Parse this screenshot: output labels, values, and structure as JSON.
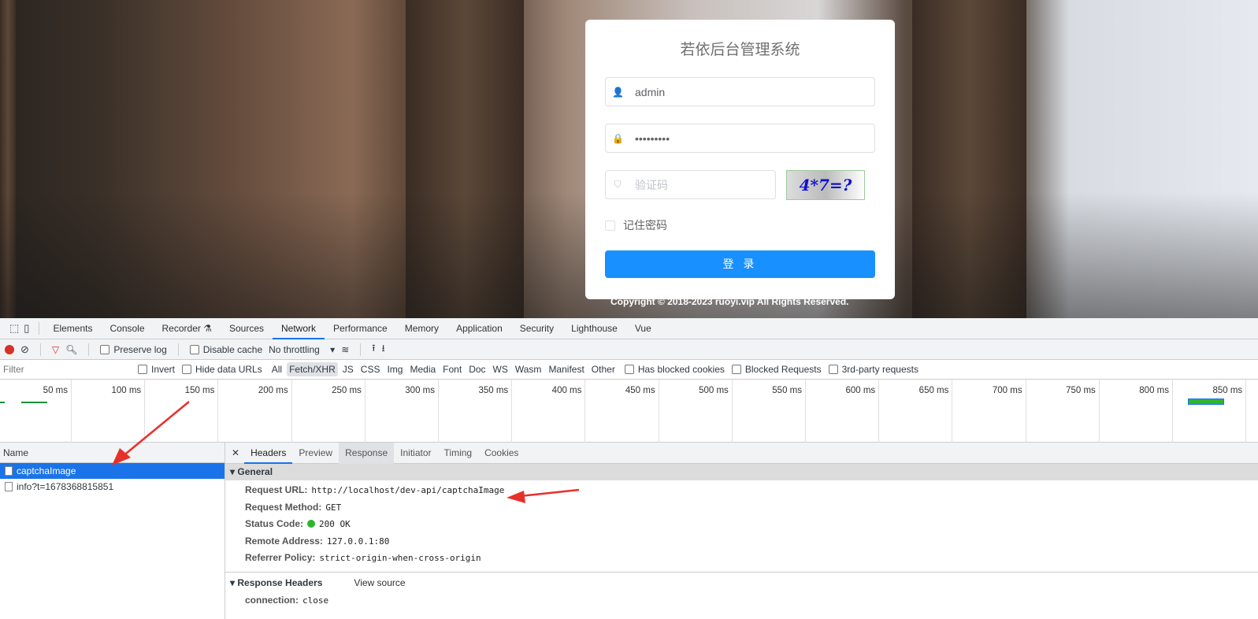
{
  "login": {
    "title": "若依后台管理系统",
    "username": "admin",
    "password": "•••••••••",
    "captcha_placeholder": "验证码",
    "captcha_text": "4*7=?",
    "remember": "记住密码",
    "submit": "登 录",
    "copyright": "Copyright © 2018-2023 ruoyi.vip All Rights Reserved."
  },
  "devtools": {
    "tabs": [
      "Elements",
      "Console",
      "Recorder ⚗",
      "Sources",
      "Network",
      "Performance",
      "Memory",
      "Application",
      "Security",
      "Lighthouse",
      "Vue"
    ],
    "active_tab": "Network",
    "toolbar": {
      "preserve_log": "Preserve log",
      "disable_cache": "Disable cache",
      "throttling": "No throttling"
    },
    "filter": {
      "placeholder": "Filter",
      "invert": "Invert",
      "hide_data_urls": "Hide data URLs",
      "types": [
        "All",
        "Fetch/XHR",
        "JS",
        "CSS",
        "Img",
        "Media",
        "Font",
        "Doc",
        "WS",
        "Wasm",
        "Manifest",
        "Other"
      ],
      "active_type": "Fetch/XHR",
      "blocked_cookies": "Has blocked cookies",
      "blocked_requests": "Blocked Requests",
      "third_party": "3rd-party requests"
    },
    "timeline_ticks": [
      "50 ms",
      "100 ms",
      "150 ms",
      "200 ms",
      "250 ms",
      "300 ms",
      "350 ms",
      "400 ms",
      "450 ms",
      "500 ms",
      "550 ms",
      "600 ms",
      "650 ms",
      "700 ms",
      "750 ms",
      "800 ms",
      "850 ms"
    ],
    "name_header": "Name",
    "requests": [
      {
        "name": "captchaImage",
        "selected": true
      },
      {
        "name": "info?t=1678368815851",
        "selected": false
      }
    ],
    "detail_tabs": [
      "Headers",
      "Preview",
      "Response",
      "Initiator",
      "Timing",
      "Cookies"
    ],
    "general_title": "General",
    "general": [
      {
        "key": "Request URL:",
        "value": "http://localhost/dev-api/captchaImage"
      },
      {
        "key": "Request Method:",
        "value": "GET"
      },
      {
        "key": "Status Code:",
        "value": "200 OK"
      },
      {
        "key": "Remote Address:",
        "value": "127.0.0.1:80"
      },
      {
        "key": "Referrer Policy:",
        "value": "strict-origin-when-cross-origin"
      }
    ],
    "response_headers_title": "Response Headers",
    "view_source": "View source",
    "response_headers": [
      {
        "key": "connection:",
        "value": "close"
      }
    ]
  },
  "colors": {
    "primary": "#1890ff",
    "devtools_accent": "#1a73e8",
    "annotation_arrow": "#e8302a"
  }
}
